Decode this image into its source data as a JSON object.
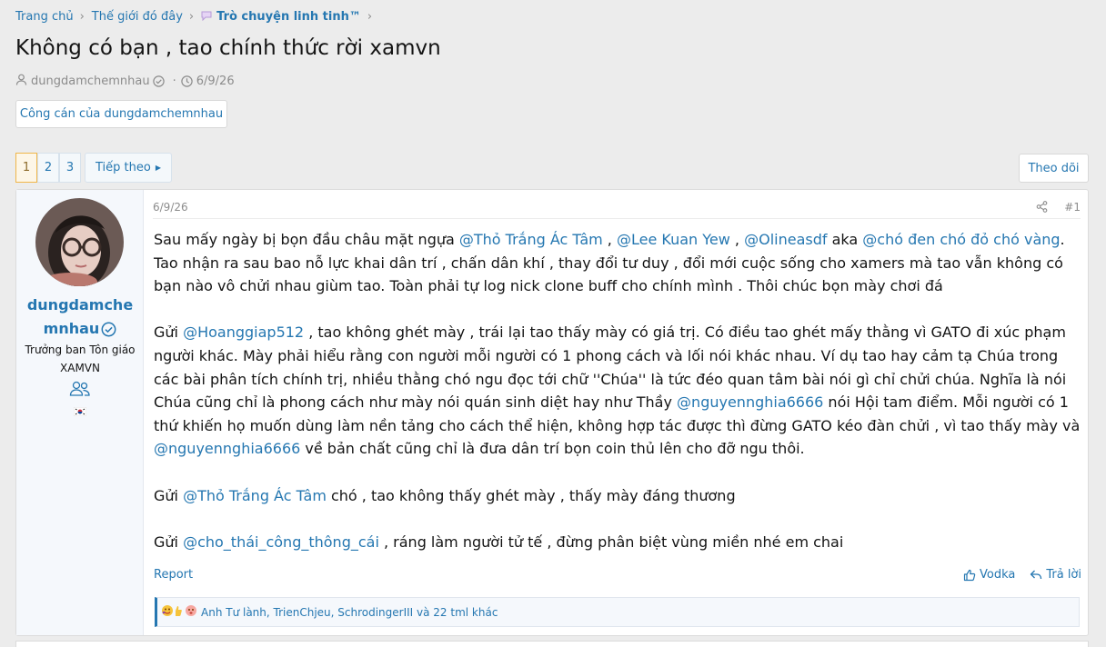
{
  "breadcrumb": {
    "items": [
      {
        "label": "Trang chủ"
      },
      {
        "label": "Thế giới đó đây"
      },
      {
        "label": "Trò chuyện linh tinh™"
      }
    ]
  },
  "thread": {
    "title": "Không có bạn , tao chính thức rời xamvn",
    "author": "dungdamchemnhau",
    "date": "6/9/26",
    "author_content_button": "Công cán của dungdamchemnhau"
  },
  "pagination": {
    "pages": [
      "1",
      "2",
      "3"
    ],
    "current": "1",
    "next_label": "Tiếp theo",
    "follow_label": "Theo dõi"
  },
  "post": {
    "date": "6/9/26",
    "number": "#1",
    "user": {
      "name_line1": "dungdamche",
      "name_line2": "mnhau",
      "title_line1": "Trưởng ban Tôn giáo",
      "title_line2": "XAMVN"
    },
    "p1": {
      "a": "Sau mấy ngày bị bọn đầu châu mặt ngựa ",
      "m1": "@Thỏ Trắng Ác Tâm",
      "b": " , ",
      "m2": "@Lee Kuan Yew",
      "c": " , ",
      "m3": "@Olineasdf",
      "d": " aka ",
      "m4": "@chó đen chó đỏ chó vàng",
      "e": ". Tao nhận ra sau bao nỗ lực khai dân trí , chấn dân khí , thay đổi tư duy , đổi mới cuộc sống cho xamers mà tao vẫn không có bạn nào vô chửi nhau giùm tao. Toàn phải tự log nick clone buff cho chính mình . Thôi chúc bọn mày chơi đá"
    },
    "p2": {
      "a": "Gửi ",
      "m1": "@Hoanggiap512",
      "b": " , tao không ghét mày , trái lại tao thấy mày có giá trị. Có điều tao ghét mấy thằng vì GATO đi xúc phạm người khác. Mày phải hiểu rằng con người mỗi người có 1 phong cách và lối nói khác nhau. Ví dụ tao hay cảm tạ Chúa trong các bài phân tích chính trị, nhiều thằng chó ngu đọc tới chữ ''Chúa'' là tức đéo quan tâm bài nói gì chỉ chửi chúa. Nghĩa là nói Chúa cũng chỉ là phong cách như mày nói quán sinh diệt hay như Thầy ",
      "m2": "@nguyennghia6666",
      "c": " nói Hội tam điểm. Mỗi người có 1 thứ khiến họ muốn dùng làm nền tảng cho cách thể hiện, không hợp tác được thì đừng GATO kéo đàn chửi , vì tao thấy mày và ",
      "m3": "@nguyennghia6666",
      "d": " về bản chất cũng chỉ là đưa dân trí bọn coin thủ lên cho đỡ ngu thôi."
    },
    "p3": {
      "a": "Gửi ",
      "m1": "@Thỏ Trắng Ác Tâm",
      "b": " chó , tao không thấy ghét mày , thấy mày đáng thương"
    },
    "p4": {
      "a": "Gửi ",
      "m1": "@cho_thái_công_thông_cái",
      "b": " , ráng làm người tử tế , đừng phân biệt vùng miền nhé em chai"
    },
    "report_label": "Report",
    "react_label": "Vodka",
    "reply_label": "Trả lời",
    "reactions_text": "Anh Tư lành, TrienChjeu, SchrodingerIII và 22 tml khác"
  },
  "icons": {
    "author": "user-icon",
    "date": "clock-icon",
    "verified": "check-circle-icon",
    "share": "share-icon",
    "group": "users-icon",
    "flag": "korea-flag-icon",
    "like": "thumbs-up-icon",
    "reply": "reply-icon"
  },
  "colors": {
    "link": "#2577b1",
    "background": "#ececec",
    "pager_current": "#f0b64a"
  }
}
